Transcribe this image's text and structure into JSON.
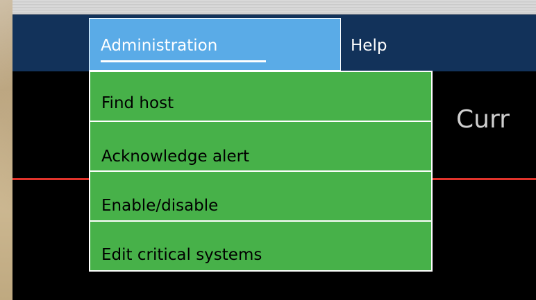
{
  "menu_bar": {
    "items": [
      {
        "label": "Administration",
        "active": true
      },
      {
        "label": "Help",
        "active": false
      }
    ]
  },
  "dropdown": {
    "items": [
      {
        "label": "Find host"
      },
      {
        "label": "Acknowledge alert"
      },
      {
        "label": "Enable/disable"
      },
      {
        "label": "Edit critical systems"
      }
    ]
  },
  "main": {
    "heading_partial": "Curr"
  },
  "colors": {
    "menu_bar_bg": "#12325a",
    "active_menu_bg": "#5aabe7",
    "dropdown_item_bg": "#47b149",
    "separator_red": "#e0332b",
    "page_bg": "#000000"
  }
}
